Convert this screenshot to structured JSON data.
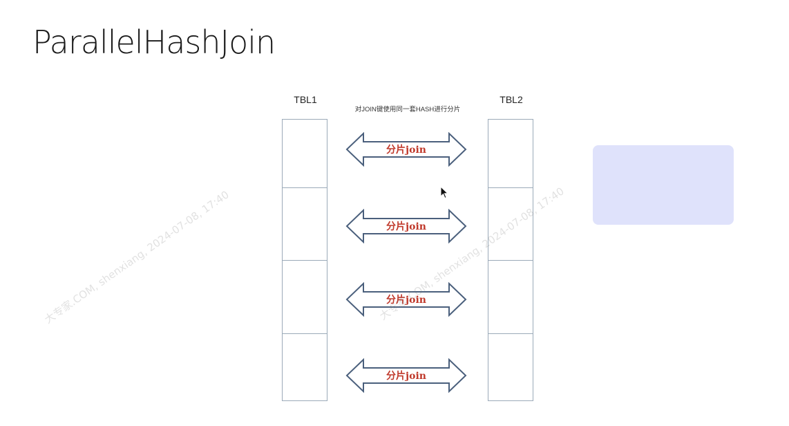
{
  "title": "ParallelHashJoin",
  "diagram": {
    "left_table": {
      "label": "TBL1",
      "partitions": 4
    },
    "right_table": {
      "label": "TBL2",
      "partitions": 4
    },
    "hash_note": "对JOIN键使用同一套HASH进行分片",
    "arrows": [
      {
        "label": "分片join"
      },
      {
        "label": "分片join"
      },
      {
        "label": "分片join"
      },
      {
        "label": "分片join"
      }
    ]
  },
  "watermark": {
    "text_a": "大专家.COM, shenxiang, 2024-07-08, 17:40",
    "text_b": "大专家.COM, shenxiang, 2024-07-08, 17:40"
  },
  "colors": {
    "arrow_stroke": "#4a5f7c",
    "arrow_label": "#c0392b",
    "table_border": "#9aa9b8",
    "side_box": "#dfe2fb"
  }
}
